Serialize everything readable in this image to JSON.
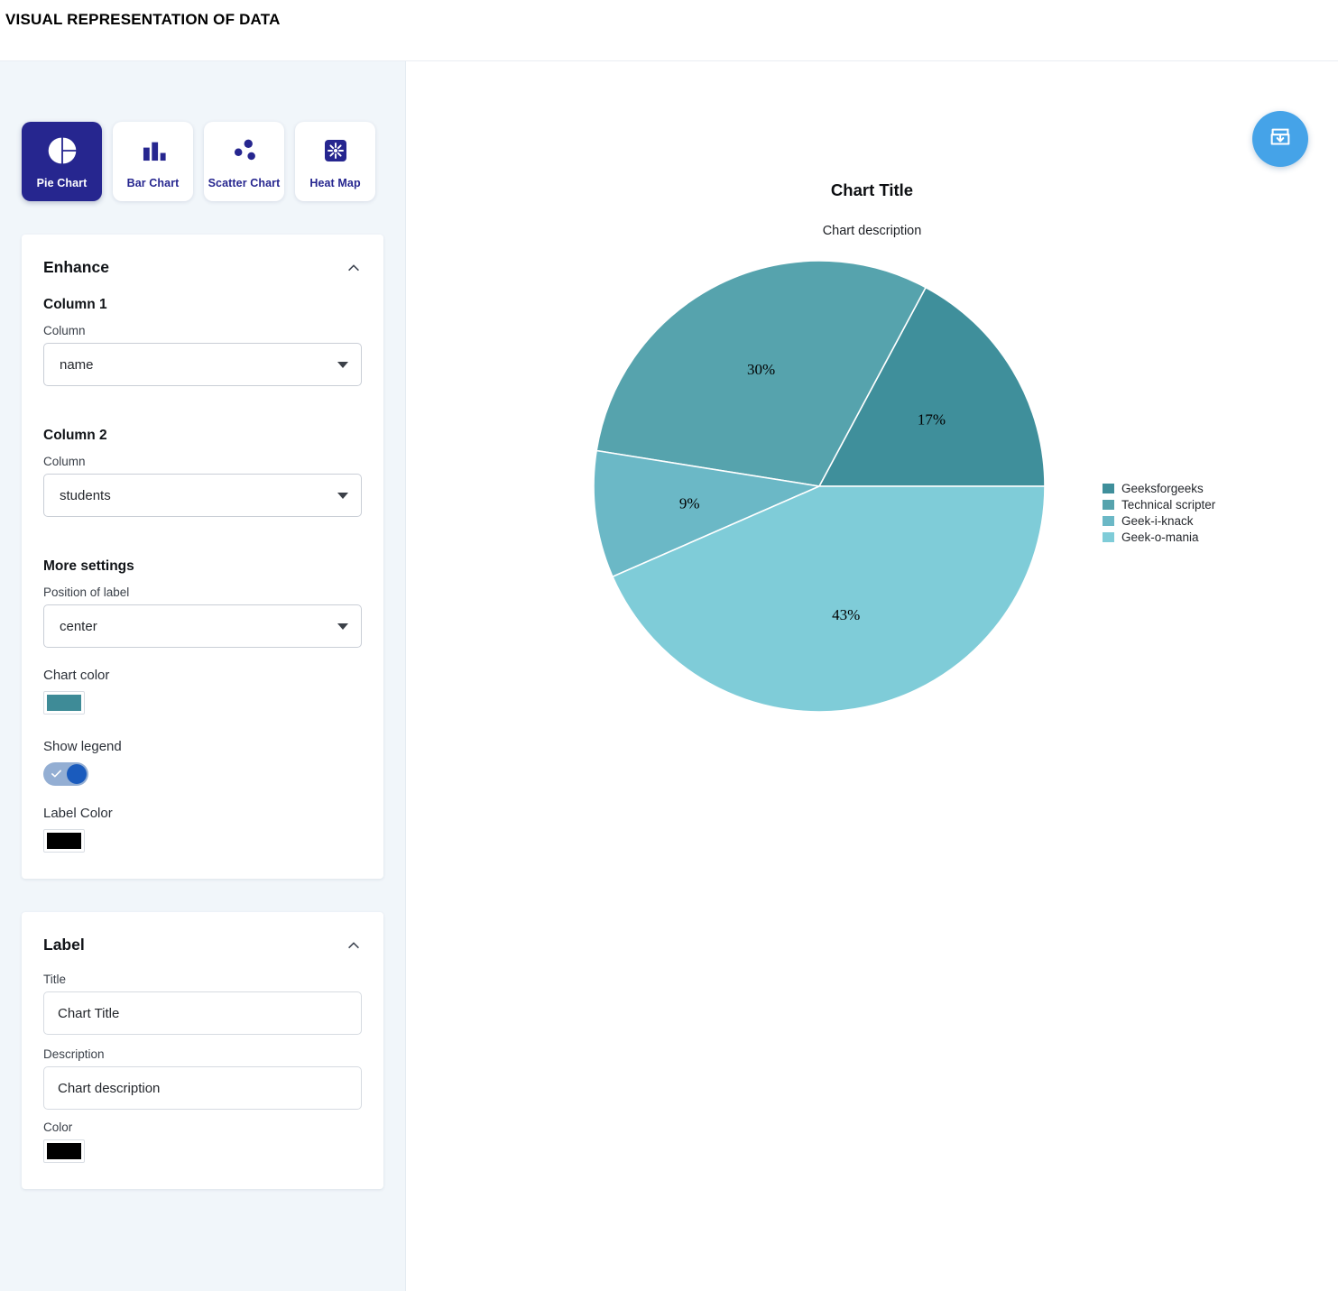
{
  "header": {
    "title": "VISUAL REPRESENTATION OF DATA"
  },
  "sidebar": {
    "chart_types": [
      {
        "label": "Pie Chart",
        "icon": "pie-chart-icon",
        "active": true
      },
      {
        "label": "Bar Chart",
        "icon": "bar-chart-icon",
        "active": false
      },
      {
        "label": "Scatter Chart",
        "icon": "scatter-chart-icon",
        "active": false
      },
      {
        "label": "Heat Map",
        "icon": "heat-map-icon",
        "active": false
      }
    ],
    "enhance_panel": {
      "title": "Enhance",
      "collapse_icon": "chevron-up-icon",
      "column1": {
        "group_label": "Column 1",
        "field_label": "Column",
        "value": "name"
      },
      "column2": {
        "group_label": "Column 2",
        "field_label": "Column",
        "value": "students"
      },
      "more_settings": {
        "group_label": "More settings",
        "position_label": "Position of label",
        "position_value": "center",
        "chart_color_label": "Chart color",
        "chart_color_value": "#3e8b97",
        "show_legend_label": "Show legend",
        "show_legend_on": "true",
        "label_color_label": "Label Color",
        "label_color_value": "#000000"
      }
    },
    "label_panel": {
      "title": "Label",
      "collapse_icon": "chevron-up-icon",
      "title_field_label": "Title",
      "title_field_value": "Chart Title",
      "description_field_label": "Description",
      "description_field_value": "Chart description",
      "color_field_label": "Color",
      "color_field_value": "#000000"
    }
  },
  "main": {
    "download_button": {
      "icon": "download-icon",
      "color": "#45a3e8"
    },
    "chart_title": "Chart Title",
    "chart_description": "Chart description"
  },
  "chart_data": {
    "type": "pie",
    "title": "Chart Title",
    "subtitle": "Chart description",
    "categories": [
      "Geeksforgeeks",
      "Technical scripter",
      "Geek-i-knack",
      "Geek-o-mania"
    ],
    "values": [
      17,
      30,
      9,
      43
    ],
    "labels": [
      "17%",
      "30%",
      "9%",
      "43%"
    ],
    "colors": [
      "#3f8f9b",
      "#56a3ad",
      "#6bb8c6",
      "#7fccd8"
    ],
    "slice_order_from_zero_ccw": [
      "Geeksforgeeks",
      "Technical scripter",
      "Geek-i-knack",
      "Geek-o-mania"
    ],
    "label_position": "center",
    "legend": {
      "show": true,
      "position": "top-right",
      "entries": [
        {
          "name": "Geeksforgeeks",
          "color": "#3f8f9b"
        },
        {
          "name": "Technical scripter",
          "color": "#56a3ad"
        },
        {
          "name": "Geek-i-knack",
          "color": "#6bb8c6"
        },
        {
          "name": "Geek-o-mania",
          "color": "#7fccd8"
        }
      ]
    },
    "slice_separator_color": "#ffffff",
    "label_color": "#000000"
  }
}
